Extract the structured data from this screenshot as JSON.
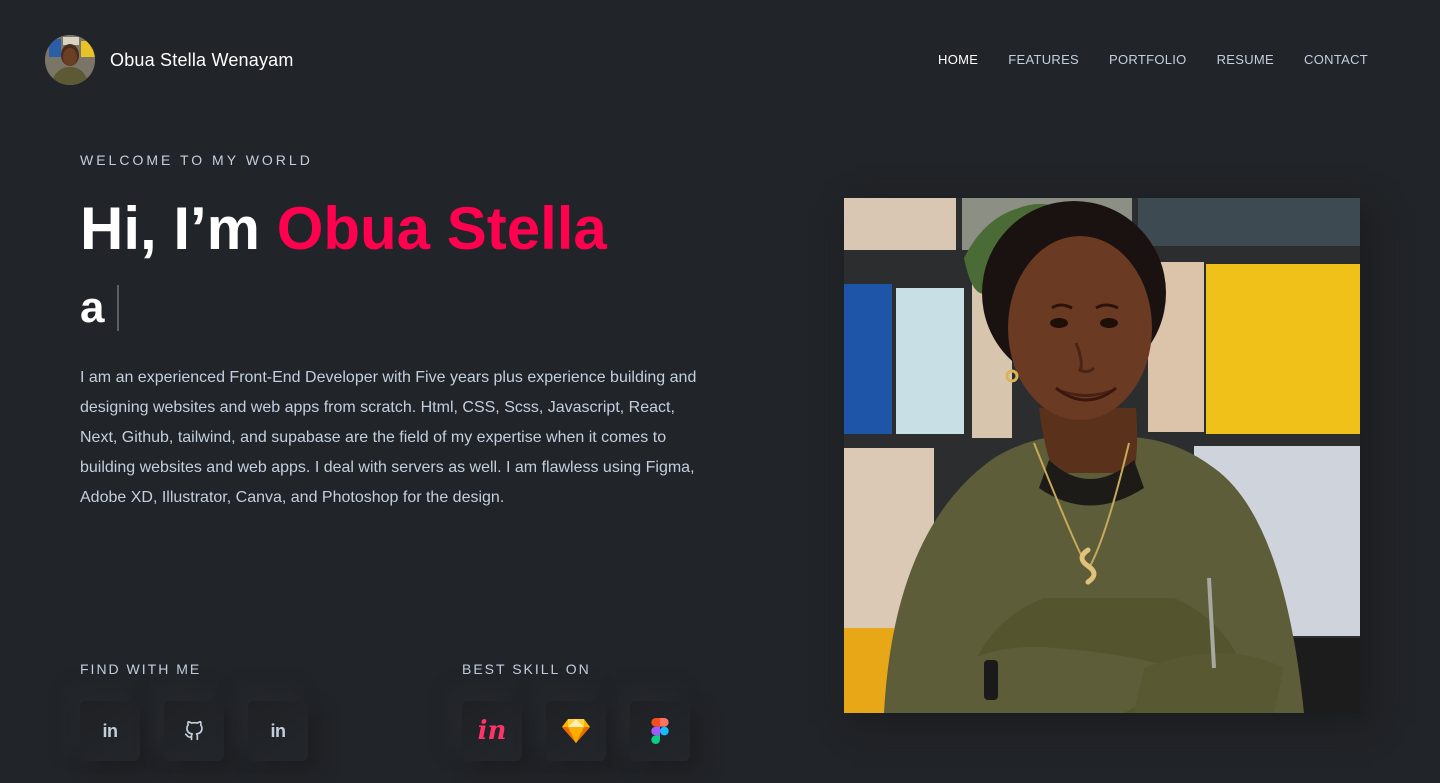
{
  "header": {
    "brand_name": "Obua Stella Wenayam",
    "nav": [
      {
        "label": "HOME",
        "active": true
      },
      {
        "label": "FEATURES",
        "active": false
      },
      {
        "label": "PORTFOLIO",
        "active": false
      },
      {
        "label": "RESUME",
        "active": false
      },
      {
        "label": "CONTACT",
        "active": false
      }
    ]
  },
  "hero": {
    "welcome": "WELCOME TO MY WORLD",
    "greeting": "Hi, I’m",
    "name": "Obua Stella",
    "typed_text": "a",
    "bio": "I am an experienced Front-End Developer with Five years plus experience building and designing websites and web apps from scratch. Html, CSS, Scss, Javascript, React, Next, Github, tailwind, and supabase are the field of my expertise when it comes to building websites and web apps. I deal with servers as well. I am flawless using Figma, Adobe XD, Illustrator, Canva, and Photoshop for the design."
  },
  "social": {
    "label": "FIND WITH ME",
    "items": [
      {
        "icon": "linkedin-icon",
        "text": "in"
      },
      {
        "icon": "github-icon"
      },
      {
        "icon": "linkedin-icon",
        "text": "in"
      }
    ]
  },
  "skills": {
    "label": "BEST SKILL ON",
    "items": [
      {
        "icon": "invision-icon",
        "text": "in"
      },
      {
        "icon": "sketch-icon"
      },
      {
        "icon": "figma-icon"
      }
    ]
  },
  "colors": {
    "background": "#212428",
    "accent": "#ff014f",
    "text": "#c4cfde",
    "heading": "#ffffff"
  }
}
